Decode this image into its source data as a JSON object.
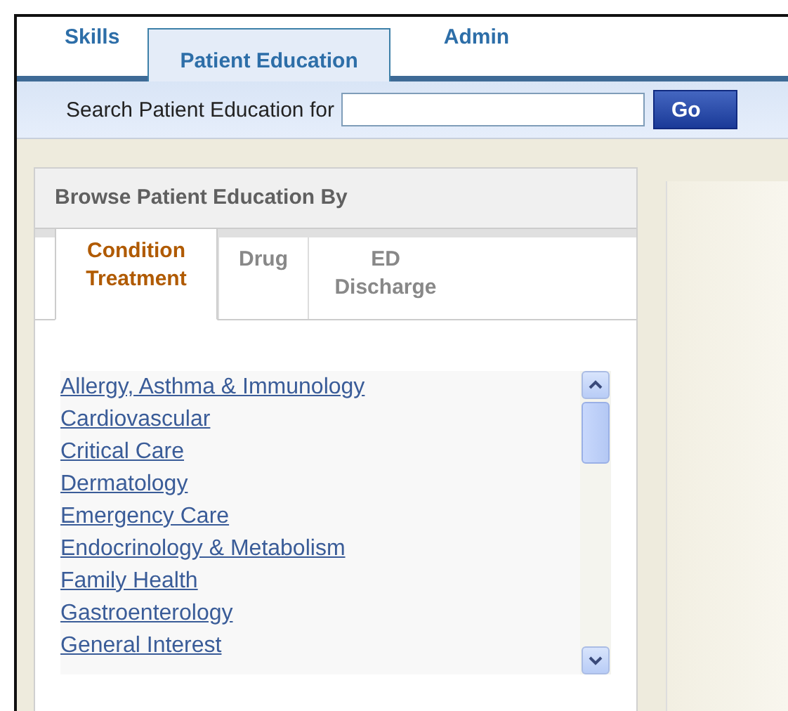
{
  "tabs": [
    {
      "label": "Skills",
      "selected": false
    },
    {
      "label": "Patient Education",
      "selected": true
    },
    {
      "label": "Admin",
      "selected": false
    }
  ],
  "search": {
    "label": "Search Patient Education for",
    "button": "Go"
  },
  "browse": {
    "title": "Browse Patient Education By",
    "tabs": [
      {
        "label": "Condition Treatment",
        "selected": true
      },
      {
        "label": "Drug",
        "selected": false
      },
      {
        "label": "ED Discharge",
        "selected": false
      }
    ],
    "items": [
      "Allergy, Asthma & Immunology",
      "Cardiovascular",
      "Critical Care",
      "Dermatology",
      "Emergency Care",
      "Endocrinology & Metabolism",
      "Family Health",
      "Gastroenterology",
      "General Interest"
    ]
  }
}
